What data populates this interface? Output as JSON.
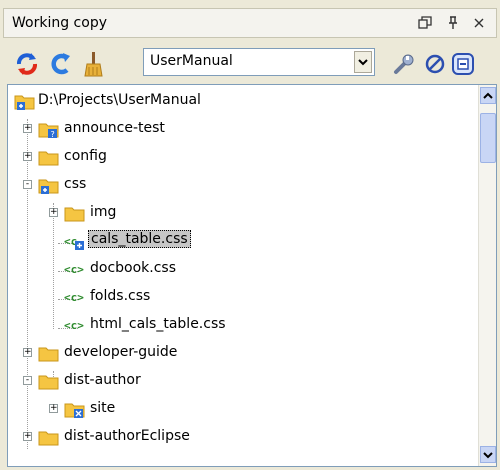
{
  "window": {
    "title": "Working copy",
    "restore_icon": "restore-icon",
    "pin_icon": "pin-icon",
    "close_icon": "close-icon"
  },
  "toolbar": {
    "refresh_icon": "refresh-icon",
    "synchronize_icon": "synchronize-icon",
    "cleanup_icon": "broom-icon",
    "working_copy_value": "UserManual",
    "settings_icon": "wrench-icon",
    "filter_icon": "filter-icon",
    "collapse_icon": "collapse-all-icon"
  },
  "tree": {
    "items": [
      {
        "label": "D:\\Projects\\UserManual",
        "icon": "folder-root-icon",
        "level": 0
      },
      {
        "label": "announce-test",
        "icon": "folder-unversioned-icon",
        "level": 1,
        "expander": "+"
      },
      {
        "label": "config",
        "icon": "folder-icon",
        "level": 1,
        "expander": "+"
      },
      {
        "label": "css",
        "icon": "folder-modified-icon",
        "level": 1,
        "expander": "-"
      },
      {
        "label": "img",
        "icon": "folder-icon",
        "level": 2,
        "expander": "+"
      },
      {
        "label": "cals_table.css",
        "icon": "css-file-modified-icon",
        "level": 2,
        "selected": true
      },
      {
        "label": "docbook.css",
        "icon": "css-file-icon",
        "level": 2
      },
      {
        "label": "folds.css",
        "icon": "css-file-icon",
        "level": 2
      },
      {
        "label": "html_cals_table.css",
        "icon": "css-file-icon",
        "level": 2
      },
      {
        "label": "developer-guide",
        "icon": "folder-icon",
        "level": 1,
        "expander": "+"
      },
      {
        "label": "dist-author",
        "icon": "folder-icon",
        "level": 1,
        "expander": "-"
      },
      {
        "label": "site",
        "icon": "folder-conflict-icon",
        "level": 2,
        "expander": "+"
      },
      {
        "label": "dist-authorEclipse",
        "icon": "folder-icon",
        "level": 1,
        "expander": "+"
      }
    ]
  },
  "colors": {
    "panel_bg": "#ece9d8",
    "folder": "#f5c542",
    "css_green": "#2e8b2e",
    "selection": "#c6c6c6"
  }
}
